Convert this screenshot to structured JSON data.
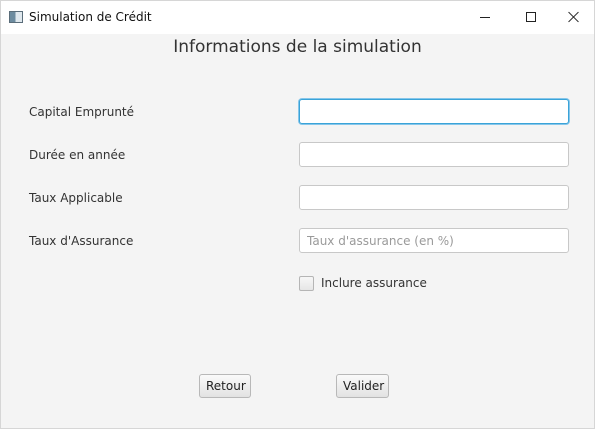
{
  "window": {
    "title": "Simulation de Crédit",
    "app_icon": "java-app-icon",
    "controls": [
      "minimize-icon",
      "maximize-icon",
      "close-icon"
    ]
  },
  "form": {
    "heading": "Informations de la simulation",
    "fields": [
      {
        "label": "Capital Emprunté",
        "value": "",
        "placeholder": "",
        "focused": true
      },
      {
        "label": "Durée en année",
        "value": "",
        "placeholder": ""
      },
      {
        "label": "Taux Applicable",
        "value": "",
        "placeholder": ""
      },
      {
        "label": "Taux d'Assurance",
        "value": "",
        "placeholder": "Taux d'assurance (en %)"
      }
    ],
    "include_insurance": {
      "label": "Inclure assurance",
      "checked": false
    }
  },
  "buttons": {
    "back_label": "Retour",
    "submit_label": "Valider"
  },
  "colors": {
    "background": "#f4f4f4",
    "focus_border": "#3aa3d8"
  }
}
